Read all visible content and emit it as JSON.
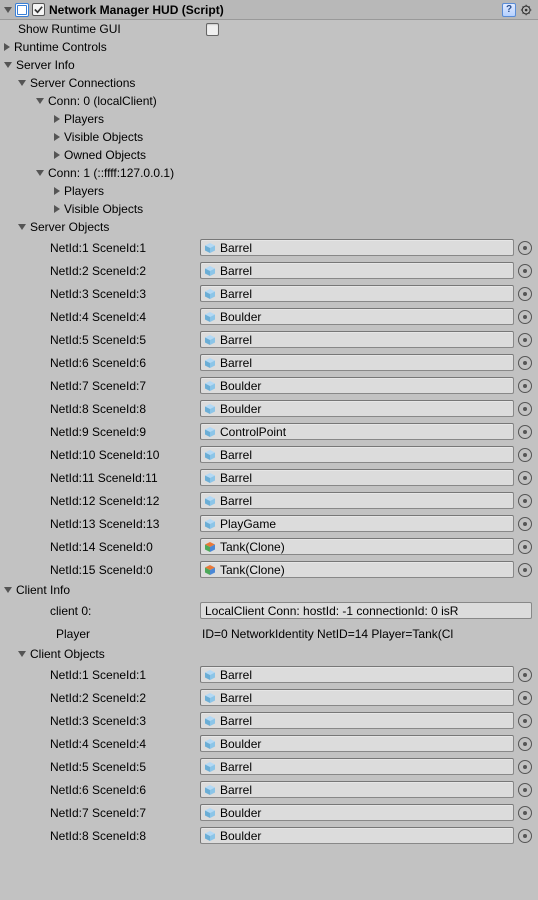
{
  "header": {
    "title": "Network Manager HUD (Script)",
    "enabled": true
  },
  "showRuntimeGui": {
    "label": "Show Runtime GUI",
    "checked": false
  },
  "tree": {
    "runtimeControls": "Runtime Controls",
    "serverInfo": "Server Info",
    "serverConnections": "Server Connections",
    "conn0": "Conn: 0 (localClient)",
    "conn0_players": "Players",
    "conn0_visible": "Visible Objects",
    "conn0_owned": "Owned Objects",
    "conn1": "Conn: 1 (::ffff:127.0.0.1)",
    "conn1_players": "Players",
    "conn1_visible": "Visible Objects",
    "serverObjects": "Server Objects",
    "clientInfo": "Client Info",
    "clientObjects": "Client Objects"
  },
  "serverObjects": [
    {
      "label": "NetId:1 SceneId:1",
      "name": "Barrel",
      "multi": false
    },
    {
      "label": "NetId:2 SceneId:2",
      "name": "Barrel",
      "multi": false
    },
    {
      "label": "NetId:3 SceneId:3",
      "name": "Barrel",
      "multi": false
    },
    {
      "label": "NetId:4 SceneId:4",
      "name": "Boulder",
      "multi": false
    },
    {
      "label": "NetId:5 SceneId:5",
      "name": "Barrel",
      "multi": false
    },
    {
      "label": "NetId:6 SceneId:6",
      "name": "Barrel",
      "multi": false
    },
    {
      "label": "NetId:7 SceneId:7",
      "name": "Boulder",
      "multi": false
    },
    {
      "label": "NetId:8 SceneId:8",
      "name": "Boulder",
      "multi": false
    },
    {
      "label": "NetId:9 SceneId:9",
      "name": "ControlPoint",
      "multi": false
    },
    {
      "label": "NetId:10 SceneId:10",
      "name": "Barrel",
      "multi": false
    },
    {
      "label": "NetId:11 SceneId:11",
      "name": "Barrel",
      "multi": false
    },
    {
      "label": "NetId:12 SceneId:12",
      "name": "Barrel",
      "multi": false
    },
    {
      "label": "NetId:13 SceneId:13",
      "name": "PlayGame",
      "multi": false
    },
    {
      "label": "NetId:14 SceneId:0",
      "name": "Tank(Clone)",
      "multi": true
    },
    {
      "label": "NetId:15 SceneId:0",
      "name": "Tank(Clone)",
      "multi": true
    }
  ],
  "clientInfoRows": {
    "client0": {
      "label": "client 0:",
      "value": "LocalClient Conn: hostId: -1 connectionId: 0 isR"
    },
    "player": {
      "label": "Player",
      "value": "ID=0 NetworkIdentity NetID=14 Player=Tank(Cl"
    }
  },
  "clientObjects": [
    {
      "label": "NetId:1 SceneId:1",
      "name": "Barrel",
      "multi": false
    },
    {
      "label": "NetId:2 SceneId:2",
      "name": "Barrel",
      "multi": false
    },
    {
      "label": "NetId:3 SceneId:3",
      "name": "Barrel",
      "multi": false
    },
    {
      "label": "NetId:4 SceneId:4",
      "name": "Boulder",
      "multi": false
    },
    {
      "label": "NetId:5 SceneId:5",
      "name": "Barrel",
      "multi": false
    },
    {
      "label": "NetId:6 SceneId:6",
      "name": "Barrel",
      "multi": false
    },
    {
      "label": "NetId:7 SceneId:7",
      "name": "Boulder",
      "multi": false
    },
    {
      "label": "NetId:8 SceneId:8",
      "name": "Boulder",
      "multi": false
    }
  ]
}
